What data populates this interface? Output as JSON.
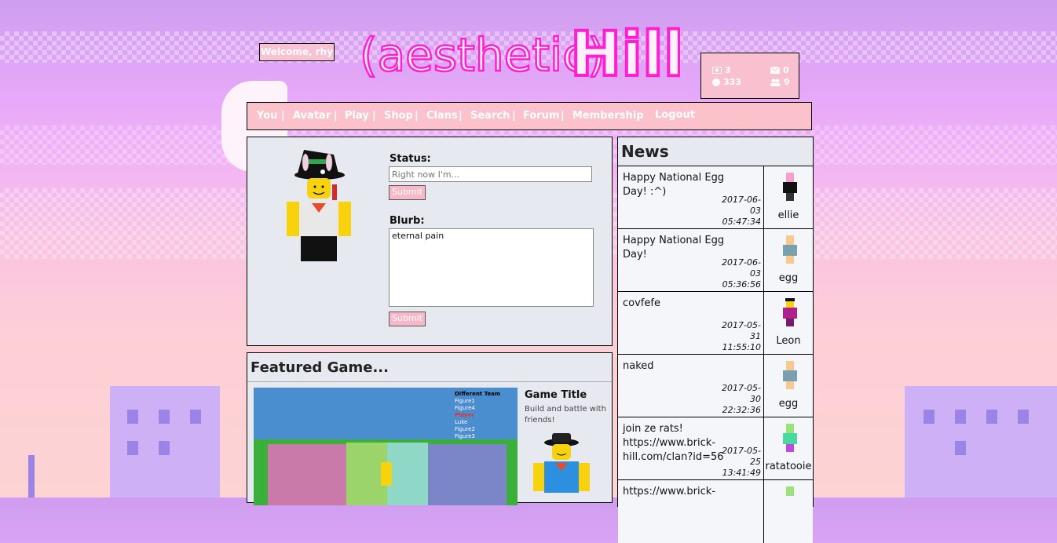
{
  "site": {
    "logo_text_left": "(aesthetic)",
    "logo_text_right": "Hill"
  },
  "welcome": "Welcome, rhy",
  "stats": {
    "views": "3",
    "messages": "0",
    "bucks": "333",
    "friends": "9"
  },
  "nav": [
    "You",
    "Avatar",
    "Play",
    "Shop",
    "Clans",
    "Search",
    "Forum",
    "Membership"
  ],
  "logout": "Logout",
  "profile": {
    "status_label": "Status:",
    "status_placeholder": "Right now I'm...",
    "submit": "Submit",
    "blurb_label": "Blurb:",
    "blurb_value": "eternal pain"
  },
  "featured": {
    "title": "Featured Game...",
    "game_title": "Game Title",
    "game_desc": "Build and battle with friends!",
    "leaderboard": [
      "Different Team",
      "Figure1",
      "Figure4",
      "Player",
      "Luke",
      "Figure2",
      "Figure3"
    ]
  },
  "news": {
    "title": "News",
    "items": [
      {
        "text": "Happy National Egg Day! :^)",
        "date": "2017-06-03 05:47:34",
        "user": "ellie"
      },
      {
        "text": "Happy National Egg Day!",
        "date": "2017-06-03 05:36:56",
        "user": "egg"
      },
      {
        "text": "covfefe",
        "date": "2017-05-31 11:55:10",
        "user": "Leon"
      },
      {
        "text": "naked",
        "date": "2017-05-30 22:32:36",
        "user": "egg"
      },
      {
        "text": "join ze rats! https://www.brick-hill.com/clan?id=56",
        "date": "2017-05-25 13:41:49",
        "user": "ratatooie"
      },
      {
        "text": "https://www.brick-",
        "date": "",
        "user": ""
      }
    ]
  },
  "colors": {
    "accent": "#fbc2cc",
    "panel": "#e6e9f0",
    "logo": "#ff1fd0"
  }
}
